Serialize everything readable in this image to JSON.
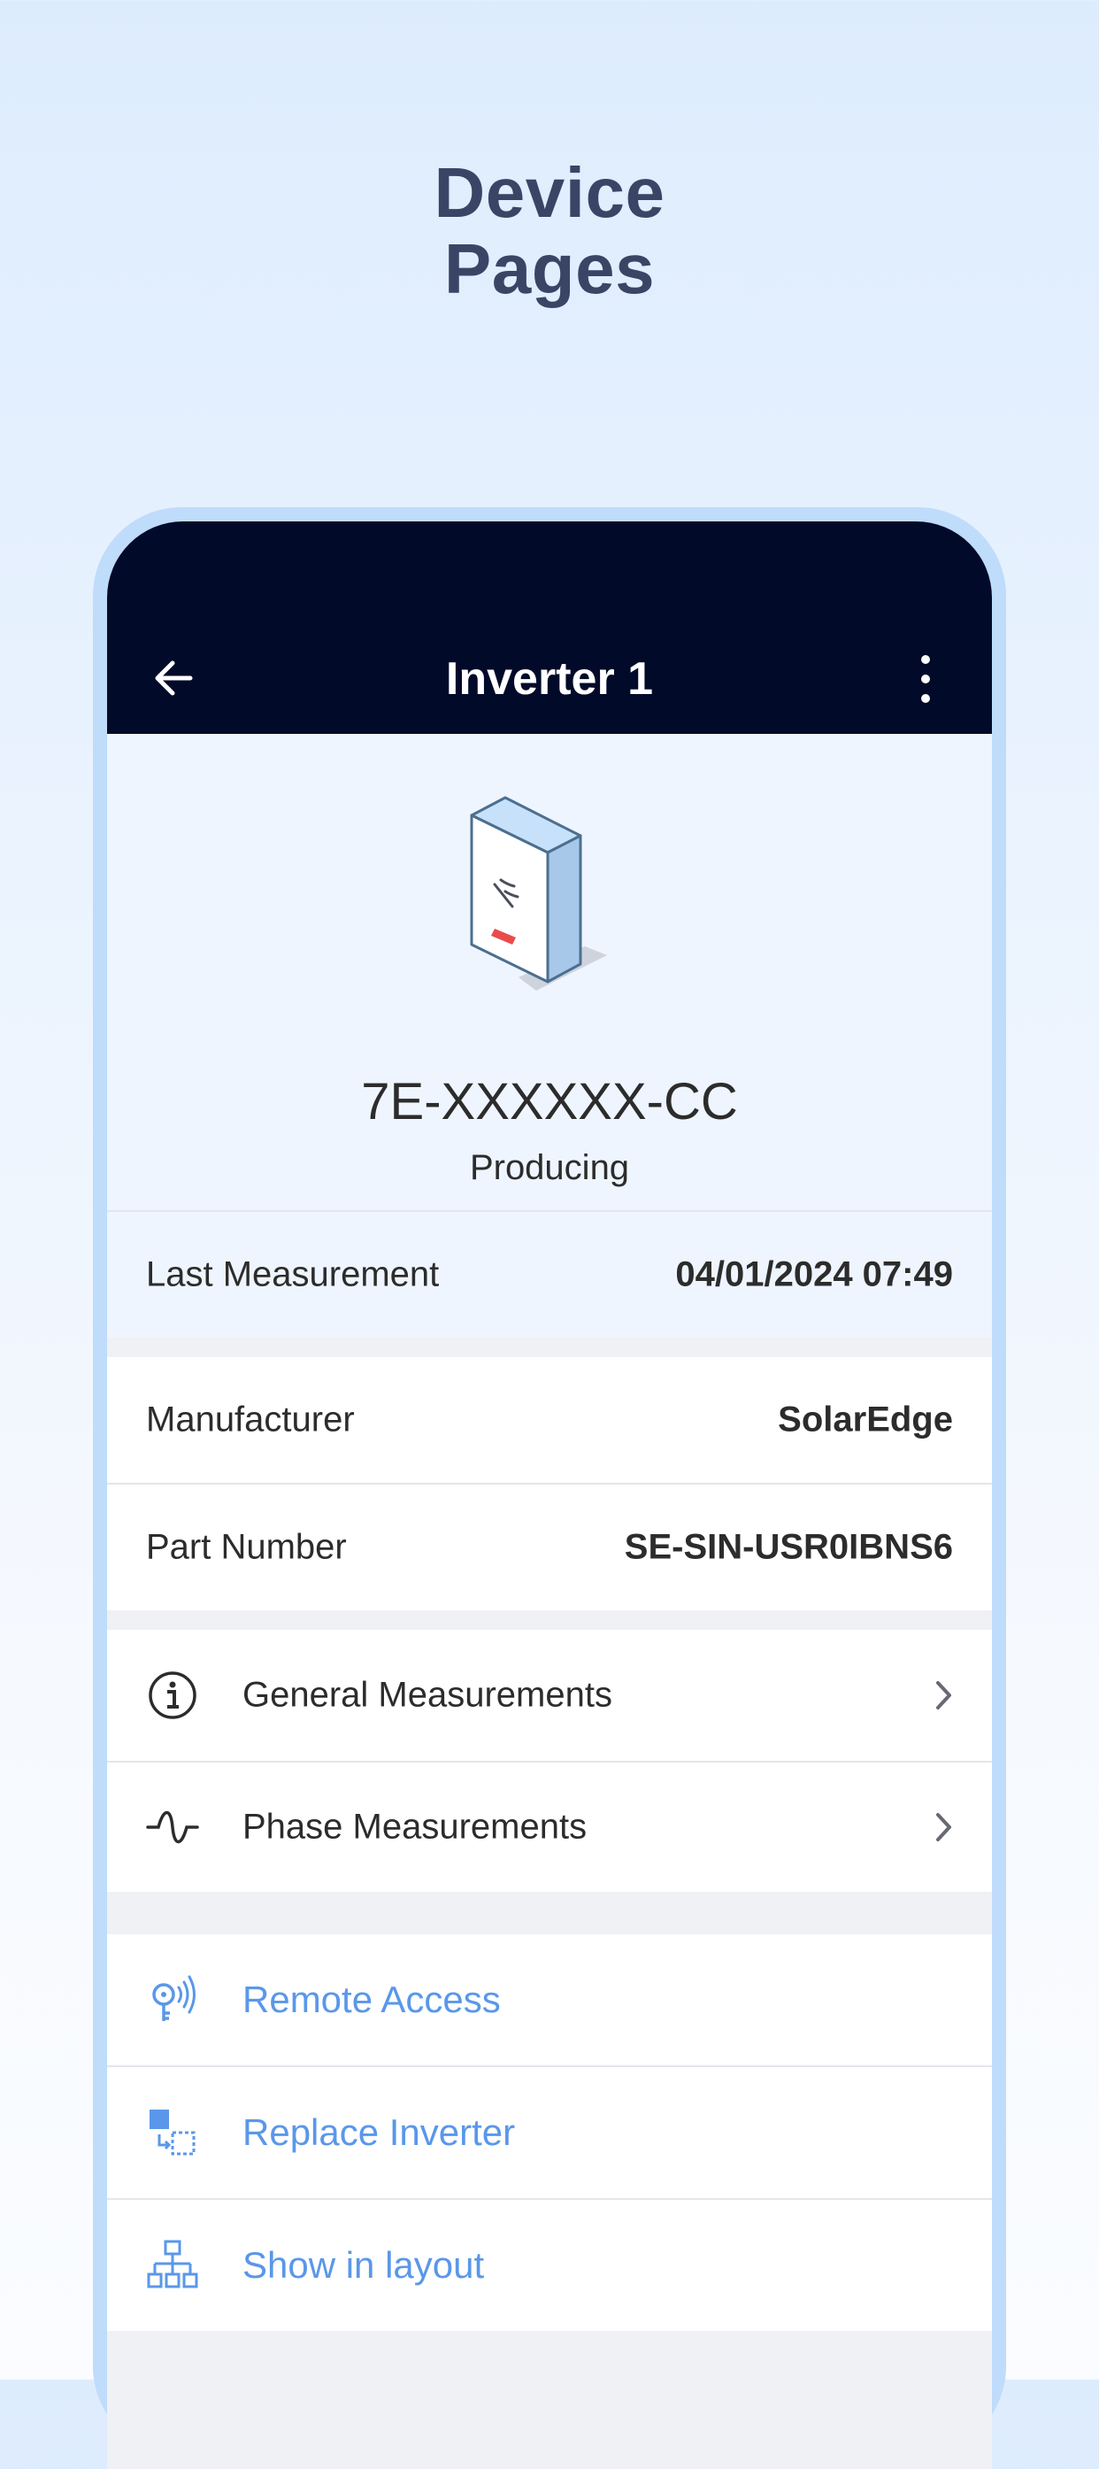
{
  "headline": {
    "line1": "Device",
    "line2": "Pages"
  },
  "appbar": {
    "title": "Inverter 1",
    "back_icon": "arrow-left-icon",
    "more_icon": "more-vertical-icon"
  },
  "device": {
    "serial": "7E-XXXXXX-CC",
    "status": "Producing",
    "image": "inverter-device-icon"
  },
  "last_measurement": {
    "label": "Last Measurement",
    "value": "04/01/2024 07:49"
  },
  "details": [
    {
      "label": "Manufacturer",
      "value": "SolarEdge"
    },
    {
      "label": "Part Number",
      "value": "SE-SIN-USR0IBNS6"
    }
  ],
  "measurements": [
    {
      "label": "General Measurements",
      "icon": "info-circle-icon"
    },
    {
      "label": "Phase Measurements",
      "icon": "sine-wave-icon"
    }
  ],
  "actions": [
    {
      "label": "Remote Access",
      "icon": "remote-key-icon"
    },
    {
      "label": "Replace Inverter",
      "icon": "replace-icon"
    },
    {
      "label": "Show in layout",
      "icon": "hierarchy-icon"
    }
  ],
  "colors": {
    "appbar": "#020a2a",
    "accent": "#5a97ea",
    "frame": "#bfdcfb",
    "headline": "#3a4566"
  }
}
